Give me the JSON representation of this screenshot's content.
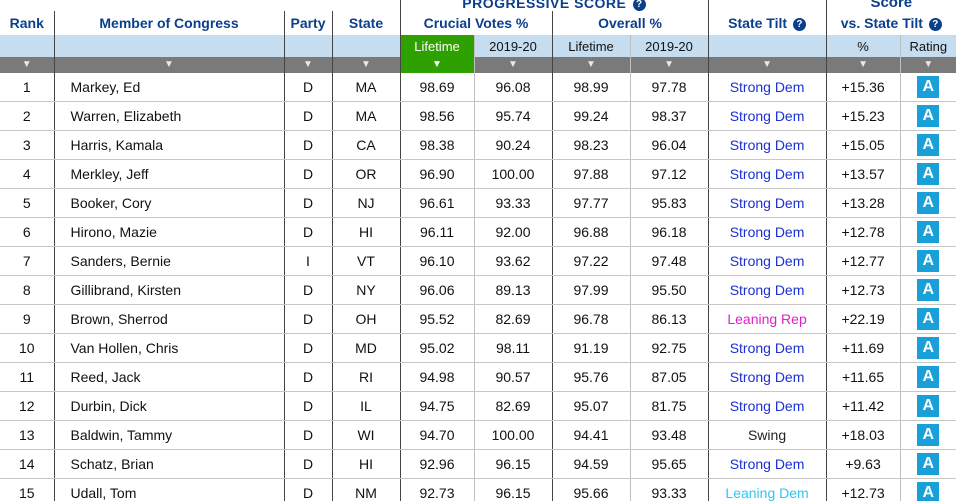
{
  "headers": {
    "progressive_score": "PROGRESSIVE SCORE",
    "score": "Score",
    "rank": "Rank",
    "member": "Member of Congress",
    "party": "Party",
    "state": "State",
    "crucial_votes": "Crucial Votes %",
    "overall": "Overall %",
    "state_tilt": "State Tilt",
    "vs_state_tilt": "vs. State Tilt",
    "help_icon": "?",
    "crucial_lifetime": "Lifetime",
    "crucial_2019": "2019-20",
    "overall_lifetime": "Lifetime",
    "overall_2019": "2019-20",
    "pct": "%",
    "rating": "Rating",
    "sort_arrow": "▼"
  },
  "colors": {
    "header_blue": "#0b3f8c",
    "subheader_bg": "#c6ddf0",
    "active_sort": "#2ea100",
    "sort_bar": "#7a7a7a",
    "strong_dem": "#1a2fd4",
    "leaning_rep": "#e020c8",
    "leaning_dem": "#2fc6f0",
    "rating_bg": "#1aa0d8"
  },
  "rows": [
    {
      "rank": "1",
      "name": "Markey, Ed",
      "party": "D",
      "state": "MA",
      "cv_life": "98.69",
      "cv_1920": "96.08",
      "ov_life": "98.99",
      "ov_1920": "97.78",
      "tilt": "Strong Dem",
      "tilt_class": "tilt-dem",
      "vs_tilt": "+15.36",
      "rating": "A"
    },
    {
      "rank": "2",
      "name": "Warren, Elizabeth",
      "party": "D",
      "state": "MA",
      "cv_life": "98.56",
      "cv_1920": "95.74",
      "ov_life": "99.24",
      "ov_1920": "98.37",
      "tilt": "Strong Dem",
      "tilt_class": "tilt-dem",
      "vs_tilt": "+15.23",
      "rating": "A"
    },
    {
      "rank": "3",
      "name": "Harris, Kamala",
      "party": "D",
      "state": "CA",
      "cv_life": "98.38",
      "cv_1920": "90.24",
      "ov_life": "98.23",
      "ov_1920": "96.04",
      "tilt": "Strong Dem",
      "tilt_class": "tilt-dem",
      "vs_tilt": "+15.05",
      "rating": "A"
    },
    {
      "rank": "4",
      "name": "Merkley, Jeff",
      "party": "D",
      "state": "OR",
      "cv_life": "96.90",
      "cv_1920": "100.00",
      "ov_life": "97.88",
      "ov_1920": "97.12",
      "tilt": "Strong Dem",
      "tilt_class": "tilt-dem",
      "vs_tilt": "+13.57",
      "rating": "A"
    },
    {
      "rank": "5",
      "name": "Booker, Cory",
      "party": "D",
      "state": "NJ",
      "cv_life": "96.61",
      "cv_1920": "93.33",
      "ov_life": "97.77",
      "ov_1920": "95.83",
      "tilt": "Strong Dem",
      "tilt_class": "tilt-dem",
      "vs_tilt": "+13.28",
      "rating": "A"
    },
    {
      "rank": "6",
      "name": "Hirono, Mazie",
      "party": "D",
      "state": "HI",
      "cv_life": "96.11",
      "cv_1920": "92.00",
      "ov_life": "96.88",
      "ov_1920": "96.18",
      "tilt": "Strong Dem",
      "tilt_class": "tilt-dem",
      "vs_tilt": "+12.78",
      "rating": "A"
    },
    {
      "rank": "7",
      "name": "Sanders, Bernie",
      "party": "I",
      "state": "VT",
      "cv_life": "96.10",
      "cv_1920": "93.62",
      "ov_life": "97.22",
      "ov_1920": "97.48",
      "tilt": "Strong Dem",
      "tilt_class": "tilt-dem",
      "vs_tilt": "+12.77",
      "rating": "A"
    },
    {
      "rank": "8",
      "name": "Gillibrand, Kirsten",
      "party": "D",
      "state": "NY",
      "cv_life": "96.06",
      "cv_1920": "89.13",
      "ov_life": "97.99",
      "ov_1920": "95.50",
      "tilt": "Strong Dem",
      "tilt_class": "tilt-dem",
      "vs_tilt": "+12.73",
      "rating": "A"
    },
    {
      "rank": "9",
      "name": "Brown, Sherrod",
      "party": "D",
      "state": "OH",
      "cv_life": "95.52",
      "cv_1920": "82.69",
      "ov_life": "96.78",
      "ov_1920": "86.13",
      "tilt": "Leaning Rep",
      "tilt_class": "tilt-rep",
      "vs_tilt": "+22.19",
      "rating": "A"
    },
    {
      "rank": "10",
      "name": "Van Hollen, Chris",
      "party": "D",
      "state": "MD",
      "cv_life": "95.02",
      "cv_1920": "98.11",
      "ov_life": "91.19",
      "ov_1920": "92.75",
      "tilt": "Strong Dem",
      "tilt_class": "tilt-dem",
      "vs_tilt": "+11.69",
      "rating": "A"
    },
    {
      "rank": "11",
      "name": "Reed, Jack",
      "party": "D",
      "state": "RI",
      "cv_life": "94.98",
      "cv_1920": "90.57",
      "ov_life": "95.76",
      "ov_1920": "87.05",
      "tilt": "Strong Dem",
      "tilt_class": "tilt-dem",
      "vs_tilt": "+11.65",
      "rating": "A"
    },
    {
      "rank": "12",
      "name": "Durbin, Dick",
      "party": "D",
      "state": "IL",
      "cv_life": "94.75",
      "cv_1920": "82.69",
      "ov_life": "95.07",
      "ov_1920": "81.75",
      "tilt": "Strong Dem",
      "tilt_class": "tilt-dem",
      "vs_tilt": "+11.42",
      "rating": "A"
    },
    {
      "rank": "13",
      "name": "Baldwin, Tammy",
      "party": "D",
      "state": "WI",
      "cv_life": "94.70",
      "cv_1920": "100.00",
      "ov_life": "94.41",
      "ov_1920": "93.48",
      "tilt": "Swing",
      "tilt_class": "tilt-swing",
      "vs_tilt": "+18.03",
      "rating": "A"
    },
    {
      "rank": "14",
      "name": "Schatz, Brian",
      "party": "D",
      "state": "HI",
      "cv_life": "92.96",
      "cv_1920": "96.15",
      "ov_life": "94.59",
      "ov_1920": "95.65",
      "tilt": "Strong Dem",
      "tilt_class": "tilt-dem",
      "vs_tilt": "+9.63",
      "rating": "A"
    },
    {
      "rank": "15",
      "name": "Udall, Tom",
      "party": "D",
      "state": "NM",
      "cv_life": "92.73",
      "cv_1920": "96.15",
      "ov_life": "95.66",
      "ov_1920": "93.33",
      "tilt": "Leaning Dem",
      "tilt_class": "tilt-lean-dem",
      "vs_tilt": "+12.73",
      "rating": "A"
    }
  ]
}
